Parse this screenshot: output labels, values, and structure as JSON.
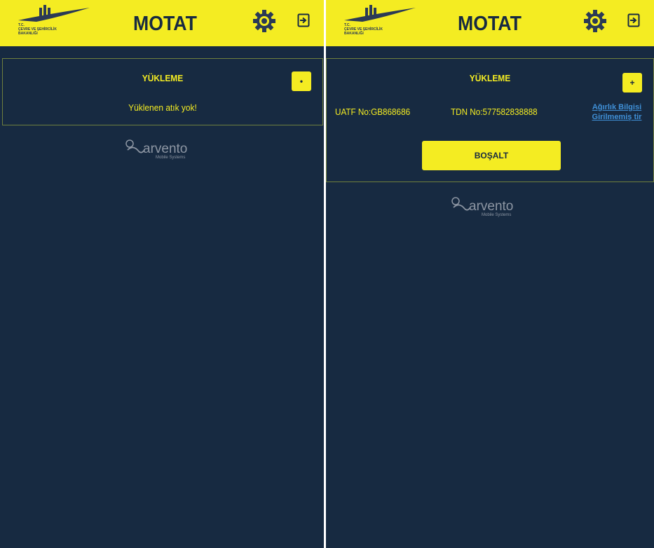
{
  "colors": {
    "background": "#172a41",
    "accent": "#f4ec22",
    "link": "#3f8fd6",
    "border": "#6f7f3e",
    "brand_gray": "#8d96a3"
  },
  "header": {
    "ministry_lines": [
      "T.C.",
      "ÇEVRE VE ŞEHİRCİLİK",
      "BAKANLIĞI"
    ],
    "title": "MOTAT",
    "settings_icon": "gear-icon",
    "logout_icon": "logout-icon"
  },
  "screens": {
    "empty": {
      "card_title": "YÜKLEME",
      "add_label": "•",
      "empty_message": "Yüklenen atık yok!"
    },
    "loaded": {
      "card_title": "YÜKLEME",
      "add_label": "+",
      "uatf": "UATF No:GB868686",
      "tdn": "TDN No:577582838888",
      "weight_link_line1": "Ağırlık Bilgisi",
      "weight_link_line2": "Girilmemiş tir",
      "unload_button": "BOŞALT"
    }
  },
  "brand": {
    "name": "arvento",
    "subtitle": "Mobile Systems"
  }
}
